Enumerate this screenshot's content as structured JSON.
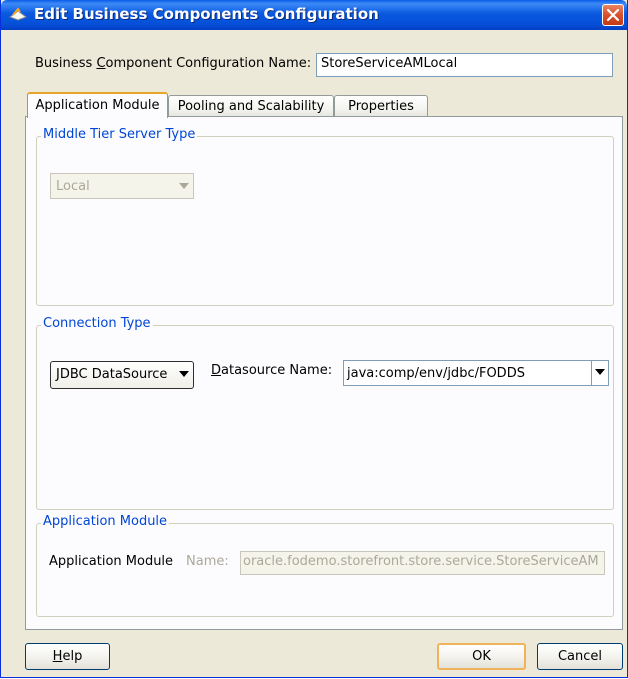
{
  "window": {
    "title": "Edit Business Components Configuration",
    "close_icon": "close-icon",
    "app_icon": "jdeveloper-icon"
  },
  "config_name": {
    "label_pre": "Business ",
    "label_mnemonic": "C",
    "label_post": "omponent Configuration Name:",
    "value": "StoreServiceAMLocal"
  },
  "tabs": [
    {
      "label": "Application Module",
      "active": true
    },
    {
      "label": "Pooling and Scalability",
      "active": false
    },
    {
      "label": "Properties",
      "active": false
    }
  ],
  "middle_tier": {
    "legend": "Middle Tier Server Type",
    "selected": "Local"
  },
  "connection": {
    "legend": "Connection Type",
    "type_selected": "JDBC DataSource",
    "ds_label_mnemonic": "D",
    "ds_label_post": "atasource Name:",
    "ds_value": "java:comp/env/jdbc/FODDS"
  },
  "app_module": {
    "legend": "Application Module",
    "label": "Application Module",
    "name_label": "Name:",
    "name_value": "oracle.fodemo.storefront.store.service.StoreServiceAM"
  },
  "buttons": {
    "help_mnemonic": "H",
    "help_post": "elp",
    "ok": "OK",
    "cancel": "Cancel"
  },
  "colors": {
    "titlebar": "#0a59e0",
    "legend_text": "#0046d5",
    "active_tab_accent": "#e8a329",
    "default_button_border": "#f0b25a"
  }
}
